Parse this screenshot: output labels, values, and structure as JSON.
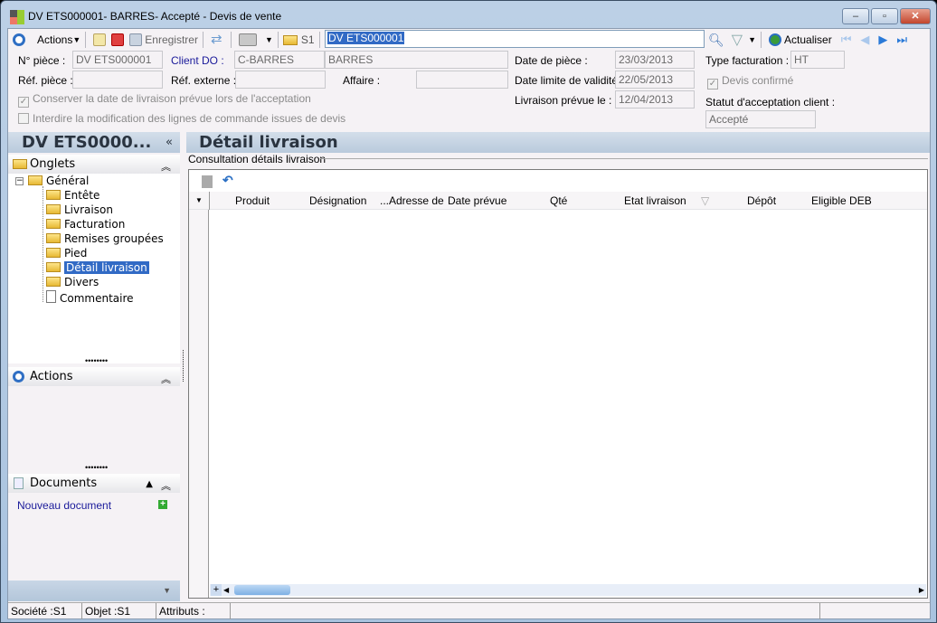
{
  "window": {
    "title": "DV ETS000001- BARRES- Accepté -  Devis de vente",
    "minimize": "–",
    "maximize": "▫",
    "close": "✕"
  },
  "toolbar": {
    "actions": "Actions",
    "save": "Enregistrer",
    "s1": "S1",
    "search_value": "DV ETS000001",
    "refresh": "Actualiser"
  },
  "form": {
    "num_piece_label": "N° pièce :",
    "num_piece": "DV ETS000001",
    "client_label": "Client DO :",
    "client_code": "C-BARRES",
    "client_name": "BARRES",
    "ref_piece_label": "Réf. pièce :",
    "ref_piece": "",
    "ref_externe_label": "Réf. externe :",
    "ref_externe": "",
    "affaire_label": "Affaire :",
    "affaire": "",
    "date_piece_label": "Date de pièce :",
    "date_piece": "23/03/2013",
    "date_limite_label": "Date limite de validité :",
    "date_limite": "22/05/2013",
    "livraison_label": "Livraison prévue le :",
    "livraison": "12/04/2013",
    "type_fact_label": "Type facturation :",
    "type_fact": "HT",
    "devis_confirme": "Devis confirmé",
    "devis_confirme_checked": true,
    "statut_label": "Statut d'acceptation client :",
    "statut": "Accepté",
    "conserver": "Conserver la date de livraison prévue lors de l'acceptation",
    "conserver_checked": true,
    "interdire": "Interdire la modification des lignes de commande issues de devis",
    "interdire_checked": false
  },
  "sidebar": {
    "title": "DV ETS0000...",
    "collapse": "«",
    "onglets": "Onglets",
    "tree": [
      {
        "label": "Général"
      },
      {
        "label": "Entête"
      },
      {
        "label": "Livraison"
      },
      {
        "label": "Facturation"
      },
      {
        "label": "Remises groupées"
      },
      {
        "label": "Pied"
      },
      {
        "label": "Détail livraison",
        "selected": true
      },
      {
        "label": "Divers"
      },
      {
        "label": "Commentaire"
      }
    ],
    "actions": "Actions",
    "documents": "Documents",
    "new_document": "Nouveau document"
  },
  "main": {
    "title": "Détail livraison",
    "group": "Consultation détails livraison",
    "columns": [
      "Produit",
      "Désignation",
      "...Adresse de",
      "Date prévue",
      "Qté",
      "Etat livraison",
      "Dépôt",
      "Eligible DEB"
    ]
  },
  "status": {
    "societe": "Société :S1",
    "objet": "Objet :S1",
    "attributs": "Attributs :"
  },
  "colors": {
    "accent": "#316ac5",
    "link": "#1a1a9a",
    "band": "#c9d6e4"
  }
}
